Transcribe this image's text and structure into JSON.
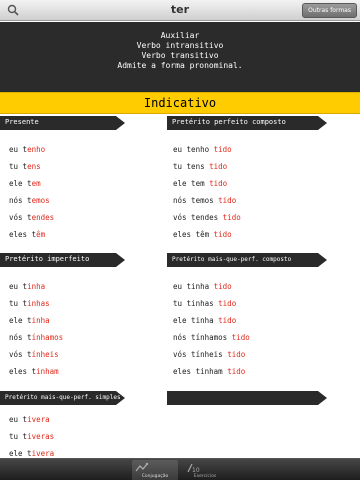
{
  "header": {
    "title": "ter",
    "other_forms_button": "Outras formas"
  },
  "info": {
    "lines": [
      "Auxiliar",
      "Verbo intransitivo",
      "Verbo transitivo",
      "Admite a forma pronominal."
    ]
  },
  "mood": "Indicativo",
  "tenses": {
    "presente": {
      "label": "Presente",
      "forms": [
        {
          "pre": "eu t",
          "end": "enho",
          "post": ""
        },
        {
          "pre": "tu t",
          "end": "ens",
          "post": ""
        },
        {
          "pre": "ele t",
          "end": "em",
          "post": ""
        },
        {
          "pre": "nós t",
          "end": "emos",
          "post": ""
        },
        {
          "pre": "vós t",
          "end": "endes",
          "post": ""
        },
        {
          "pre": "eles t",
          "end": "êm",
          "post": ""
        }
      ]
    },
    "perfeito_composto": {
      "label": "Pretérito perfeito composto",
      "forms": [
        {
          "pre": "eu tenho ",
          "end": "tido",
          "post": ""
        },
        {
          "pre": "tu tens ",
          "end": "tido",
          "post": ""
        },
        {
          "pre": "ele tem ",
          "end": "tido",
          "post": ""
        },
        {
          "pre": "nós temos ",
          "end": "tido",
          "post": ""
        },
        {
          "pre": "vós tendes ",
          "end": "tido",
          "post": ""
        },
        {
          "pre": "eles têm ",
          "end": "tido",
          "post": ""
        }
      ]
    },
    "imperfeito": {
      "label": "Pretérito imperfeito",
      "forms": [
        {
          "pre": "eu t",
          "end": "inha",
          "post": ""
        },
        {
          "pre": "tu t",
          "end": "inhas",
          "post": ""
        },
        {
          "pre": "ele t",
          "end": "inha",
          "post": ""
        },
        {
          "pre": "nós t",
          "end": "ínhamos",
          "post": ""
        },
        {
          "pre": "vós t",
          "end": "ínheis",
          "post": ""
        },
        {
          "pre": "eles t",
          "end": "inham",
          "post": ""
        }
      ]
    },
    "mais_que_perf_composto": {
      "label": "Pretérito mais-que-perf. composto",
      "forms": [
        {
          "pre": "eu tinha ",
          "end": "tido",
          "post": ""
        },
        {
          "pre": "tu tinhas ",
          "end": "tido",
          "post": ""
        },
        {
          "pre": "ele tinha ",
          "end": "tido",
          "post": ""
        },
        {
          "pre": "nós tínhamos ",
          "end": "tido",
          "post": ""
        },
        {
          "pre": "vós tínheis ",
          "end": "tido",
          "post": ""
        },
        {
          "pre": "eles tinham ",
          "end": "tido",
          "post": ""
        }
      ]
    },
    "mais_que_perf_simples": {
      "label": "Pretérito mais-que-perf. simples",
      "forms": [
        {
          "pre": "eu t",
          "end": "ivera",
          "post": ""
        },
        {
          "pre": "tu t",
          "end": "iveras",
          "post": ""
        },
        {
          "pre": "ele t",
          "end": "ivera",
          "post": ""
        }
      ]
    },
    "empty": {
      "label": ""
    }
  },
  "tabs": [
    {
      "label": "Conjugação",
      "icon": "conjugation-icon",
      "active": true
    },
    {
      "label": "Exercícios",
      "icon": "exercises-icon",
      "active": false
    }
  ],
  "colors": {
    "accent_yellow": "#ffcc00",
    "ending_red": "#e0281a",
    "dark_band": "#2b2b2b"
  }
}
